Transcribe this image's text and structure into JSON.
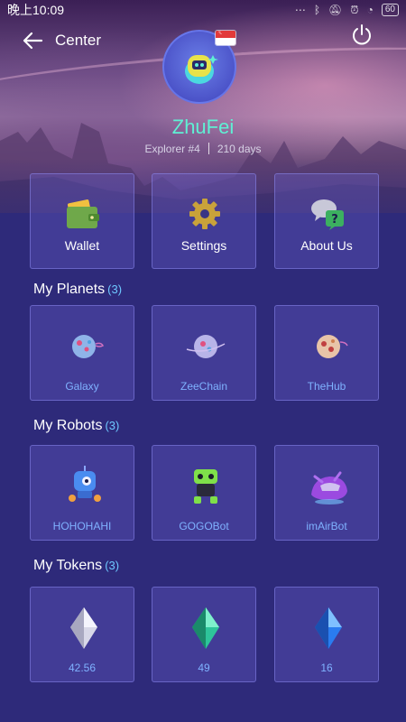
{
  "status_bar": {
    "time": "晚上10:09",
    "battery": "60"
  },
  "header": {
    "title": "Center"
  },
  "profile": {
    "username": "ZhuFei",
    "rank": "Explorer #4",
    "days": "210 days"
  },
  "menu": [
    {
      "label": "Wallet",
      "icon": "wallet-icon"
    },
    {
      "label": "Settings",
      "icon": "gear-icon"
    },
    {
      "label": "About Us",
      "icon": "chat-bubbles-icon"
    }
  ],
  "planets": {
    "title": "My Planets",
    "count": "(3)",
    "items": [
      {
        "label": "Galaxy",
        "icon": "planet-icon",
        "color": "#8fb4e8"
      },
      {
        "label": "ZeeChain",
        "icon": "planet-icon",
        "color": "#b8b4e8"
      },
      {
        "label": "TheHub",
        "icon": "planet-icon",
        "color": "#e8c4a8"
      }
    ]
  },
  "robots": {
    "title": "My Robots",
    "count": "(3)",
    "items": [
      {
        "label": "HOHOHAHI",
        "icon": "robot-icon",
        "color": "#4a8cf0"
      },
      {
        "label": "GOGOBot",
        "icon": "robot-icon",
        "color": "#7fe04a"
      },
      {
        "label": "imAirBot",
        "icon": "robot-icon",
        "color": "#9b4ae0"
      }
    ]
  },
  "tokens": {
    "title": "My Tokens",
    "count": "(3)",
    "items": [
      {
        "label": "42.56",
        "icon": "crystal-icon",
        "color": "#d8d8e8"
      },
      {
        "label": "49",
        "icon": "crystal-icon",
        "color": "#2ec49a"
      },
      {
        "label": "16",
        "icon": "crystal-icon",
        "color": "#2a7cf0"
      }
    ]
  },
  "colors": {
    "accent": "#5ff0d4",
    "background": "#2e2a7a",
    "count": "#6ec8ff",
    "item_label": "#7fb2ff"
  }
}
